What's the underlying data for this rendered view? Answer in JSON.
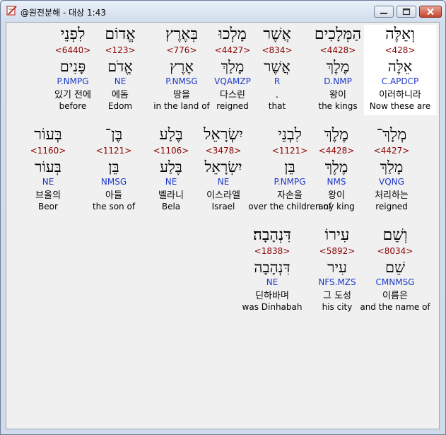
{
  "window": {
    "title": "@원전분해 - 대상 1:43"
  },
  "colors": {
    "strong": "#8b0000",
    "morph": "#1c38c8",
    "text": "#000000",
    "background": "#f0f0f0"
  },
  "icons": {
    "app": "book-pencil-icon",
    "minimize": "minimize-icon",
    "maximize": "maximize-icon",
    "close": "close-icon"
  },
  "rows": [
    {
      "words": [
        {
          "heb": "וְאֵלֶּה",
          "strong": "<428>",
          "heb2": "אֵלֶּה",
          "morph": "C.APDCP",
          "kor": "이러하니라",
          "eng": "Now these are",
          "selected": true
        },
        {
          "heb": "הַמְּלָכִים",
          "strong": "<4428>",
          "heb2": "מֶלֶךְ",
          "morph": "D.NMP",
          "kor": "왕이",
          "eng": "the kings"
        },
        {
          "heb": "אֲשֶׁר",
          "strong": "<834>",
          "heb2": "אֲשֶׁר",
          "morph": "R",
          "kor": ".",
          "eng": "that"
        },
        {
          "heb": "מָלְכוּ",
          "strong": "<4427>",
          "heb2": "מָלַךְ",
          "morph": "VQAMZP",
          "kor": "다스린",
          "eng": "reigned"
        },
        {
          "heb": "בְּאֶרֶץ",
          "strong": "<776>",
          "heb2": "אֶרֶץ",
          "morph": "P.NMSG",
          "kor": "땅을",
          "eng": "in the land of"
        },
        {
          "heb": "אֱדוֹם",
          "strong": "<123>",
          "heb2": "אֱדֹם",
          "morph": "NE",
          "kor": "에돔",
          "eng": "Edom"
        },
        {
          "heb": "לִפְנֵי",
          "strong": "<6440>",
          "heb2": "פָּנִים",
          "morph": "P.NMPG",
          "kor": "있기 전에",
          "eng": "before"
        }
      ]
    },
    {
      "words": [
        {
          "heb": "מְלָךְ־",
          "strong": "<4427>",
          "heb2": "מָלַךְ",
          "morph": "VQNG",
          "kor": "처리하는",
          "eng": "reigned"
        },
        {
          "heb": "מֶלֶךְ",
          "strong": "<4428>",
          "heb2": "מֶלֶךְ",
          "morph": "NMS",
          "kor": "왕이",
          "eng": "any king"
        },
        {
          "heb": "לִבְנֵי",
          "strong": "<1121>",
          "heb2": "בֵּן",
          "morph": "P.NMPG",
          "kor": "자손을",
          "eng": "over the children of"
        },
        {
          "heb": "יִשְׂרָאֵל",
          "strong": "<3478>",
          "heb2": "יִשְׂרָאֵל",
          "morph": "NE",
          "kor": "이스라엘",
          "eng": "Israel"
        },
        {
          "heb": "בֶּלַע",
          "strong": "<1106>",
          "heb2": "בֶּלַע",
          "morph": "NE",
          "kor": "벨라니",
          "eng": "Bela"
        },
        {
          "heb": "בֶּן־",
          "strong": "<1121>",
          "heb2": "בֵּן",
          "morph": "NMSG",
          "kor": "아들",
          "eng": "the son of"
        },
        {
          "heb": "בְּעוֹר",
          "strong": "<1160>",
          "heb2": "בְּעוֹר",
          "morph": "NE",
          "kor": "브올의",
          "eng": "Beor"
        }
      ]
    },
    {
      "words": [
        {
          "heb": "וְשֵׁם",
          "strong": "<8034>",
          "heb2": "שֵׁם",
          "morph": "CMNMSG",
          "kor": "이름은",
          "eng": "and the name of"
        },
        {
          "heb": "עִירוֹ",
          "strong": "<5892>",
          "heb2": "עִיר",
          "morph": "NFS.MZS",
          "kor": "그 도성",
          "eng": "his city"
        },
        {
          "heb": "דִּנְהָבָה׃",
          "strong": "<1838>",
          "heb2": "דִּנְהָבָה",
          "morph": "NE",
          "kor": "딘하바며",
          "eng": "was Dinhabah"
        }
      ]
    }
  ]
}
